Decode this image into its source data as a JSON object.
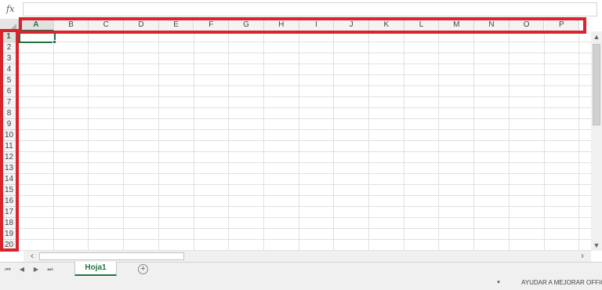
{
  "formula_bar": {
    "fx_label": "fx",
    "value": ""
  },
  "sheet": {
    "columns": [
      "A",
      "B",
      "C",
      "D",
      "E",
      "F",
      "G",
      "H",
      "I",
      "J",
      "K",
      "L",
      "M",
      "N",
      "O",
      "P"
    ],
    "rows": [
      "1",
      "2",
      "3",
      "4",
      "5",
      "6",
      "7",
      "8",
      "9",
      "10",
      "11",
      "12",
      "13",
      "14",
      "15",
      "16",
      "17",
      "18",
      "19",
      "20"
    ],
    "selected_column": "A",
    "selected_row": "1"
  },
  "tabs": {
    "active_sheet": "Hoja1",
    "add_sheet_label": "+"
  },
  "status": {
    "help_text": "AYUDAR A MEJORAR OFFICE",
    "dropdown_label": "▾"
  },
  "colors": {
    "accent": "#217346",
    "highlight": "#d9232d"
  }
}
